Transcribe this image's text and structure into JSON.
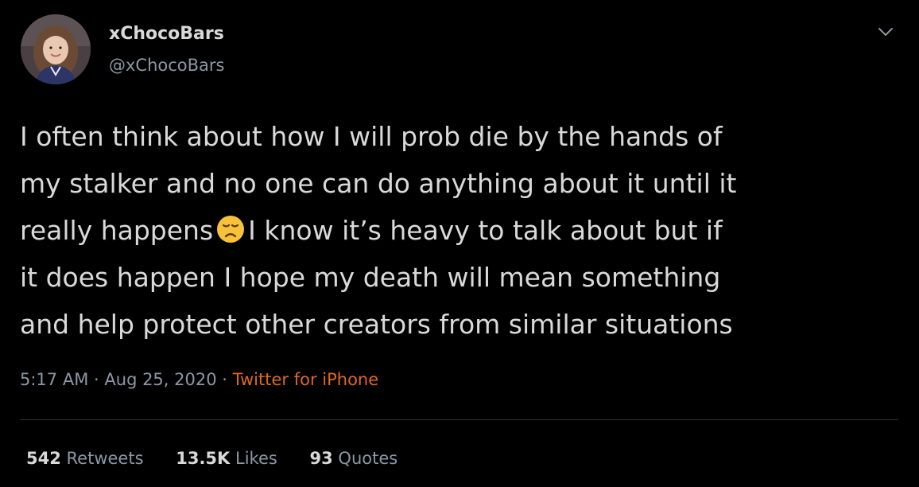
{
  "author": {
    "display_name": "xChocoBars",
    "handle": "@xChocoBars",
    "avatar_icon": "profile-photo"
  },
  "tweet": {
    "lines": [
      "I often think about how I will prob die by the hands of",
      "my stalker and no one can do anything about it until it",
      "really happens",
      "I know it’s heavy to talk about but if",
      "it does happen I hope my death will mean something",
      "and help protect other creators from similar situations"
    ],
    "emoji": "disappointed-face"
  },
  "meta": {
    "time": "5:17 AM",
    "separator": "·",
    "date": "Aug 25, 2020",
    "source": "Twitter for iPhone"
  },
  "stats": {
    "retweets_count": "542",
    "retweets_label": "Retweets",
    "likes_count": "13.5K",
    "likes_label": "Likes",
    "quotes_count": "93",
    "quotes_label": "Quotes"
  },
  "colors": {
    "background": "#000000",
    "text": "#d9d9d9",
    "secondary": "#8b98a5",
    "source_link": "#e0681e",
    "divider": "#2f3336"
  }
}
